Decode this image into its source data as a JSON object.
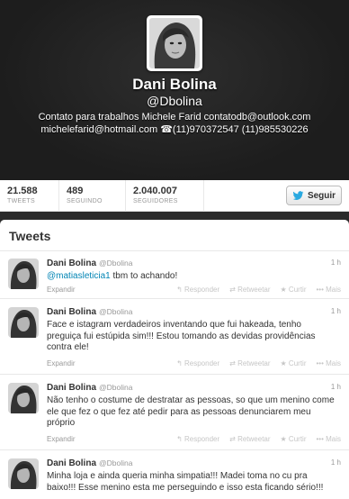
{
  "profile": {
    "display_name": "Dani Bolina",
    "handle": "@Dbolina",
    "bio_line1": "Contato para trabalhos Michele Farid contatodb@outlook.com",
    "bio_line2": "michelefarid@hotmail.com ☎(11)970372547 (11)985530226"
  },
  "stats": {
    "tweets_count": "21.588",
    "tweets_label": "TWEETS",
    "following_count": "489",
    "following_label": "SEGUINDO",
    "followers_count": "2.040.007",
    "followers_label": "SEGUIDORES"
  },
  "follow_button": {
    "label": "Seguir",
    "icon": "twitter-bird-icon",
    "color": "#2aa9e0"
  },
  "panel": {
    "title": "Tweets"
  },
  "actions": {
    "reply": "↰ Responder",
    "retweet": "⇄ Retweetar",
    "favorite": "★ Curtir",
    "more": "••• Mais",
    "expand": "Expandir"
  },
  "tweets": [
    {
      "name": "Dani Bolina",
      "username": "@Dbolina",
      "time": "1 h",
      "mention": "@matiasleticia1",
      "text": " tbm to achando!"
    },
    {
      "name": "Dani Bolina",
      "username": "@Dbolina",
      "time": "1 h",
      "mention": "",
      "text": "Face e istagram verdadeiros inventando que fui hakeada, tenho preguiça fui estúpida sim!!! Estou tomando as devidas providências contra ele!"
    },
    {
      "name": "Dani Bolina",
      "username": "@Dbolina",
      "time": "1 h",
      "mention": "",
      "text": "Não tenho o costume de destratar as pessoas, so que um menino come ele que fez o que fez até pedir para as pessoas denunciarem meu próprio"
    },
    {
      "name": "Dani Bolina",
      "username": "@Dbolina",
      "time": "1 h",
      "mention": "",
      "text": "Minha loja e ainda queria minha simpatia!!! Madei toma no cu pra baixo!!! Esse menino esta me perseguindo e isso esta ficando sério!!!"
    }
  ],
  "colors": {
    "link": "#0084b4",
    "header_bg": "#1f1f1f"
  }
}
